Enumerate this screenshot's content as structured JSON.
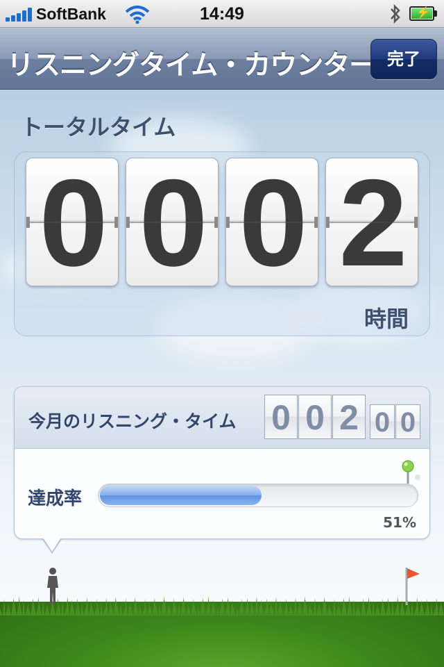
{
  "status_bar": {
    "carrier": "SoftBank",
    "time": "14:49",
    "icons": [
      "signal-icon",
      "wifi-icon",
      "bluetooth-icon",
      "battery-charging-icon"
    ]
  },
  "nav_bar": {
    "title": "リスニングタイム・カウンター",
    "done_label": "完了"
  },
  "total_time": {
    "title": "トータルタイム",
    "digits": [
      "0",
      "0",
      "0",
      "2"
    ],
    "unit": "時間"
  },
  "monthly": {
    "title": "今月のリスニング・タイム",
    "hour_digits": [
      "0",
      "0",
      "2"
    ],
    "minute_digits": [
      "0",
      "0"
    ],
    "rate_label": "達成率",
    "progress_percent": 51,
    "progress_text": "51%"
  },
  "colors": {
    "nav_bar": "#6d7fa0",
    "done_button": "#142c66",
    "progress_fill": "#6f9fe6",
    "grass": "#3e8a1c",
    "flag": "#e8572a"
  }
}
